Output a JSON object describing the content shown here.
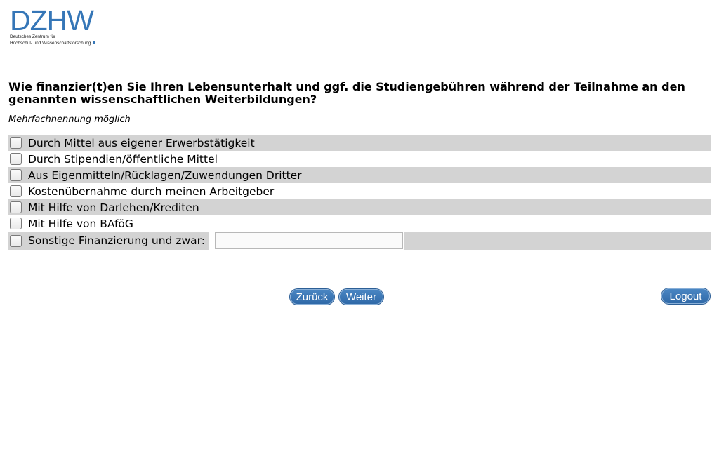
{
  "logo": {
    "mark": "DZHW",
    "line1": "Deutsches Zentrum für",
    "line2": "Hochschul- und Wissenschaftsforschung"
  },
  "question": {
    "text": "Wie finanzier(t)en Sie Ihren Lebensunterhalt und ggf. die Studiengebühren während der Teilnahme an den genannten wissenschaftlichen Weiterbildungen?",
    "instruction": "Mehrfachnennung möglich"
  },
  "options": [
    {
      "label": "Durch Mittel aus eigener Erwerbstätigkeit",
      "checked": false
    },
    {
      "label": "Durch Stipendien/öffentliche Mittel",
      "checked": false
    },
    {
      "label": "Aus Eigenmitteln/Rücklagen/Zuwendungen Dritter",
      "checked": false
    },
    {
      "label": "Kostenübernahme durch meinen Arbeitgeber",
      "checked": false
    },
    {
      "label": "Mit Hilfe von Darlehen/Krediten",
      "checked": false
    },
    {
      "label": "Mit Hilfe von BAföG",
      "checked": false
    }
  ],
  "other_option": {
    "label": "Sonstige Finanzierung und zwar:",
    "checked": false,
    "value": ""
  },
  "nav": {
    "back_label": "Zurück",
    "next_label": "Weiter",
    "logout_label": "Logout"
  },
  "colors": {
    "brand": "#3576b7",
    "row_shade": "#d3d3d3",
    "button": "#2f69a8"
  }
}
